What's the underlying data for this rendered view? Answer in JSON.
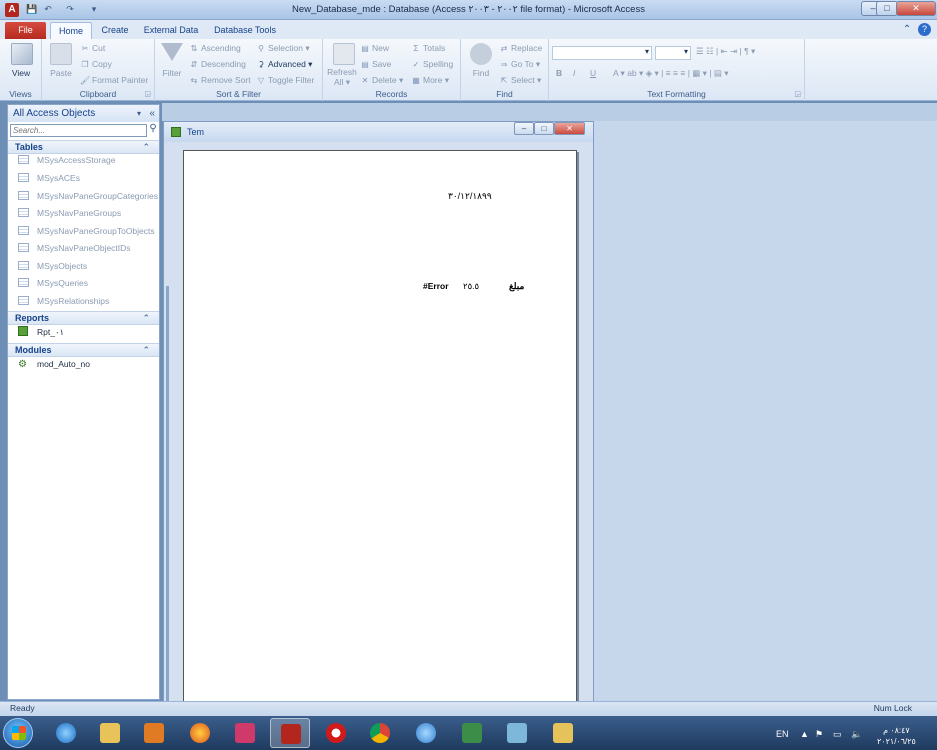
{
  "window": {
    "title": "New_Database_mde : Database (Access ٢٠٠٢ - ٢٠٠٣ file format) - Microsoft Access",
    "app_icon": "A",
    "controls": {
      "minimize": "–",
      "maximize": "□",
      "close": "✕"
    }
  },
  "quick_access": {
    "save_icon": "💾",
    "undo_icon": "↶",
    "redo_icon": "↷",
    "customize_icon": "▾"
  },
  "tabs": {
    "file": "File",
    "home": "Home",
    "create": "Create",
    "external_data": "External Data",
    "database_tools": "Database Tools"
  },
  "help": {
    "minimize_ribbon": "⌃",
    "help": "?"
  },
  "ribbon": {
    "views": {
      "view": "View",
      "label": "Views"
    },
    "clipboard": {
      "paste": "Paste",
      "cut": "Cut",
      "copy": "Copy",
      "format_painter": "Format Painter",
      "label": "Clipboard"
    },
    "sort_filter": {
      "filter": "Filter",
      "ascending": "Ascending",
      "descending": "Descending",
      "remove_sort": "Remove Sort",
      "selection": "Selection",
      "advanced": "Advanced",
      "toggle_filter": "Toggle Filter",
      "label": "Sort & Filter"
    },
    "records": {
      "refresh": "Refresh",
      "refresh_all": "All",
      "new": "New",
      "save": "Save",
      "delete": "Delete",
      "totals": "Totals",
      "spelling": "Spelling",
      "more": "More",
      "label": "Records"
    },
    "find": {
      "find": "Find",
      "replace": "Replace",
      "go_to": "Go To",
      "select": "Select",
      "label": "Find"
    },
    "text_formatting": {
      "label": "Text Formatting",
      "bold": "B",
      "italic": "I",
      "underline": "U"
    }
  },
  "navpane": {
    "header": "All Access Objects",
    "search_placeholder": "Search...",
    "sections": [
      {
        "title": "Tables",
        "items": [
          "MSysAccessStorage",
          "MSysACEs",
          "MSysNavPaneGroupCategories",
          "MSysNavPaneGroups",
          "MSysNavPaneGroupToObjects",
          "MSysNavPaneObjectIDs",
          "MSysObjects",
          "MSysQueries",
          "MSysRelationships"
        ]
      },
      {
        "title": "Reports",
        "items": [
          "Rpt_٠١"
        ]
      },
      {
        "title": "Modules",
        "items": [
          "mod_Auto_no"
        ]
      }
    ]
  },
  "report": {
    "window_title": "Tem",
    "date": "٣٠/١٢/١٨٩٩",
    "error_text": "#Error",
    "value": "٢٥.٥",
    "label": "مبلغ"
  },
  "statusbar": {
    "left": "Ready",
    "right": "Num Lock"
  },
  "taskbar": {
    "lang": "EN",
    "time": "٠٨:٤٧ م",
    "date": "٢٠٢١/٠٦/٢٥"
  }
}
